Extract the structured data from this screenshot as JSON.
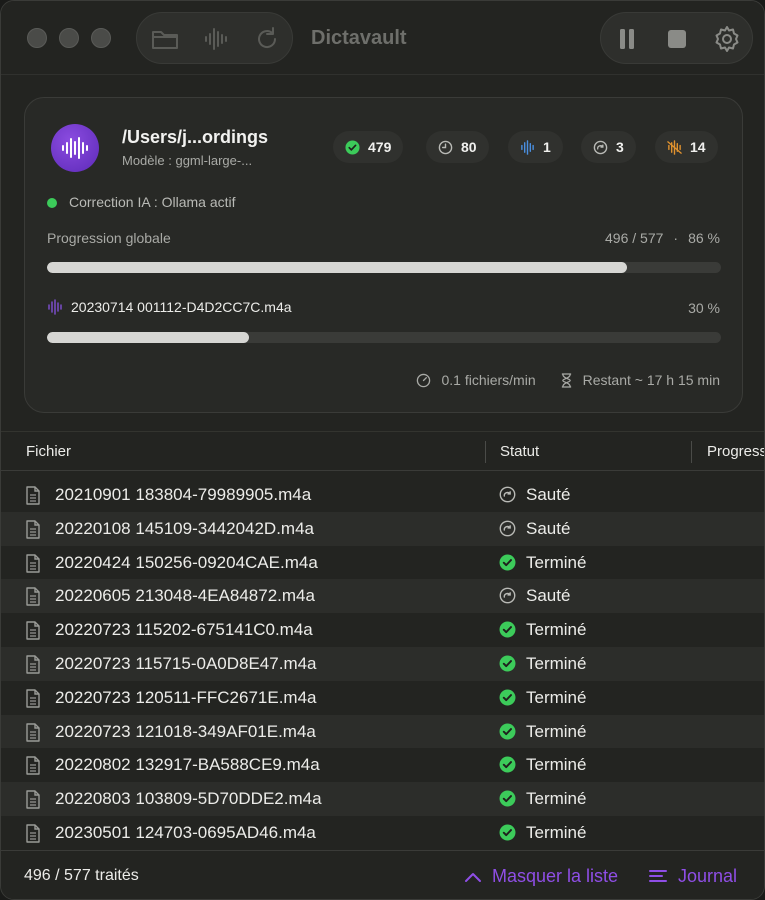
{
  "app": {
    "title": "Dictavault"
  },
  "card": {
    "path": "/Users/j...ordings",
    "model": "Modèle : ggml-large-...",
    "stats": {
      "done": "479",
      "pending": "80",
      "in_progress": "1",
      "skipped": "3",
      "errors": "14"
    },
    "ai_status": "Correction IA : Ollama actif",
    "global_progress": {
      "label": "Progression globale",
      "count": "496 / 577",
      "separator": "·",
      "percent": "86 %",
      "fraction": 0.86
    },
    "current_file": {
      "name": "20230714 001112-D4D2CC7C.m4a",
      "percent": "30 %",
      "fraction": 0.3
    },
    "rate": "0.1 fichiers/min",
    "remaining": "Restant ~ 17 h 15 min"
  },
  "table": {
    "columns": [
      "Fichier",
      "Statut",
      "Progress"
    ],
    "rows": [
      {
        "file": "20210901 183804-79989905.m4a",
        "status": "Sauté"
      },
      {
        "file": "20220108 145109-3442042D.m4a",
        "status": "Sauté"
      },
      {
        "file": "20220424 150256-09204CAE.m4a",
        "status": "Terminé"
      },
      {
        "file": "20220605 213048-4EA84872.m4a",
        "status": "Sauté"
      },
      {
        "file": "20220723 115202-675141C0.m4a",
        "status": "Terminé"
      },
      {
        "file": "20220723 115715-0A0D8E47.m4a",
        "status": "Terminé"
      },
      {
        "file": "20220723 120511-FFC2671E.m4a",
        "status": "Terminé"
      },
      {
        "file": "20220723 121018-349AF01E.m4a",
        "status": "Terminé"
      },
      {
        "file": "20220802 132917-BA588CE9.m4a",
        "status": "Terminé"
      },
      {
        "file": "20220803 103809-5D70DDE2.m4a",
        "status": "Terminé"
      },
      {
        "file": "20230501 124703-0695AD46.m4a",
        "status": "Terminé"
      }
    ]
  },
  "footer": {
    "count": "496 / 577 traités",
    "hide_list": "Masquer la liste",
    "journal": "Journal"
  },
  "colors": {
    "accent": "#8f4ee6",
    "success": "#3ccb5a",
    "blue": "#4a8fe0",
    "orange": "#e0922e"
  },
  "icons": {
    "toolbar": [
      "folder-icon",
      "waveform-icon",
      "refresh-icon"
    ],
    "controls": [
      "pause-icon",
      "stop-icon",
      "gear-icon"
    ],
    "stats": [
      "check-circle-icon",
      "clock-icon",
      "waveform-icon",
      "skip-icon",
      "error-waveform-icon"
    ],
    "footer": [
      "chevron-up-icon",
      "list-icon"
    ]
  }
}
